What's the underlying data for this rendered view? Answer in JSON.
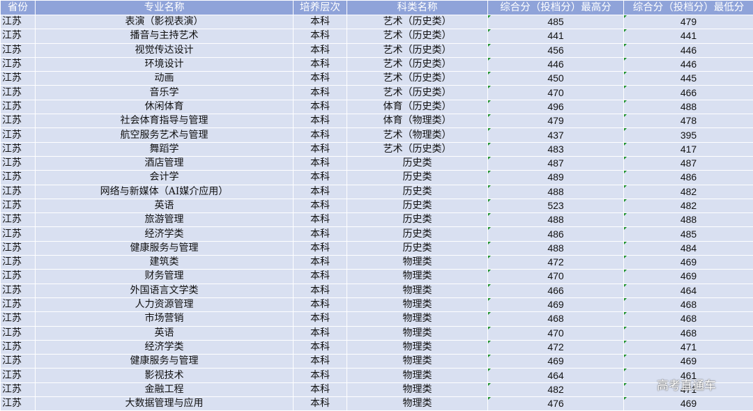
{
  "headers": [
    "省份",
    "专业名称",
    "培养层次",
    "科类名称",
    "综合分（投档分）最高分",
    "综合分（投档分）最低分"
  ],
  "rows": [
    [
      "江苏",
      "表演（影视表演）",
      "本科",
      "艺术（历史类）",
      "485",
      "479"
    ],
    [
      "江苏",
      "播音与主持艺术",
      "本科",
      "艺术（历史类）",
      "441",
      "441"
    ],
    [
      "江苏",
      "视觉传达设计",
      "本科",
      "艺术（历史类）",
      "456",
      "446"
    ],
    [
      "江苏",
      "环境设计",
      "本科",
      "艺术（历史类）",
      "446",
      "446"
    ],
    [
      "江苏",
      "动画",
      "本科",
      "艺术（历史类）",
      "450",
      "445"
    ],
    [
      "江苏",
      "音乐学",
      "本科",
      "艺术（历史类）",
      "470",
      "466"
    ],
    [
      "江苏",
      "休闲体育",
      "本科",
      "体育（历史类）",
      "496",
      "488"
    ],
    [
      "江苏",
      "社会体育指导与管理",
      "本科",
      "体育（物理类）",
      "479",
      "478"
    ],
    [
      "江苏",
      "航空服务艺术与管理",
      "本科",
      "艺术（物理类）",
      "437",
      "395"
    ],
    [
      "江苏",
      "舞蹈学",
      "本科",
      "艺术（历史类）",
      "483",
      "417"
    ],
    [
      "江苏",
      "酒店管理",
      "本科",
      "历史类",
      "487",
      "487"
    ],
    [
      "江苏",
      "会计学",
      "本科",
      "历史类",
      "489",
      "486"
    ],
    [
      "江苏",
      "网络与新媒体（AI媒介应用）",
      "本科",
      "历史类",
      "488",
      "482"
    ],
    [
      "江苏",
      "英语",
      "本科",
      "历史类",
      "523",
      "482"
    ],
    [
      "江苏",
      "旅游管理",
      "本科",
      "历史类",
      "488",
      "488"
    ],
    [
      "江苏",
      "经济学类",
      "本科",
      "历史类",
      "486",
      "485"
    ],
    [
      "江苏",
      "健康服务与管理",
      "本科",
      "历史类",
      "488",
      "484"
    ],
    [
      "江苏",
      "建筑类",
      "本科",
      "物理类",
      "472",
      "469"
    ],
    [
      "江苏",
      "财务管理",
      "本科",
      "物理类",
      "470",
      "469"
    ],
    [
      "江苏",
      "外国语言文学类",
      "本科",
      "物理类",
      "466",
      "464"
    ],
    [
      "江苏",
      "人力资源管理",
      "本科",
      "物理类",
      "469",
      "468"
    ],
    [
      "江苏",
      "市场营销",
      "本科",
      "物理类",
      "468",
      "468"
    ],
    [
      "江苏",
      "英语",
      "本科",
      "物理类",
      "470",
      "468"
    ],
    [
      "江苏",
      "经济学类",
      "本科",
      "物理类",
      "472",
      "471"
    ],
    [
      "江苏",
      "健康服务与管理",
      "本科",
      "物理类",
      "469",
      "469"
    ],
    [
      "江苏",
      "影视技术",
      "本科",
      "物理类",
      "464",
      "461"
    ],
    [
      "江苏",
      "金融工程",
      "本科",
      "物理类",
      "482",
      "471"
    ],
    [
      "江苏",
      "大数据管理与应用",
      "本科",
      "物理类",
      "476",
      "469"
    ]
  ],
  "watermark": "高考直通车"
}
